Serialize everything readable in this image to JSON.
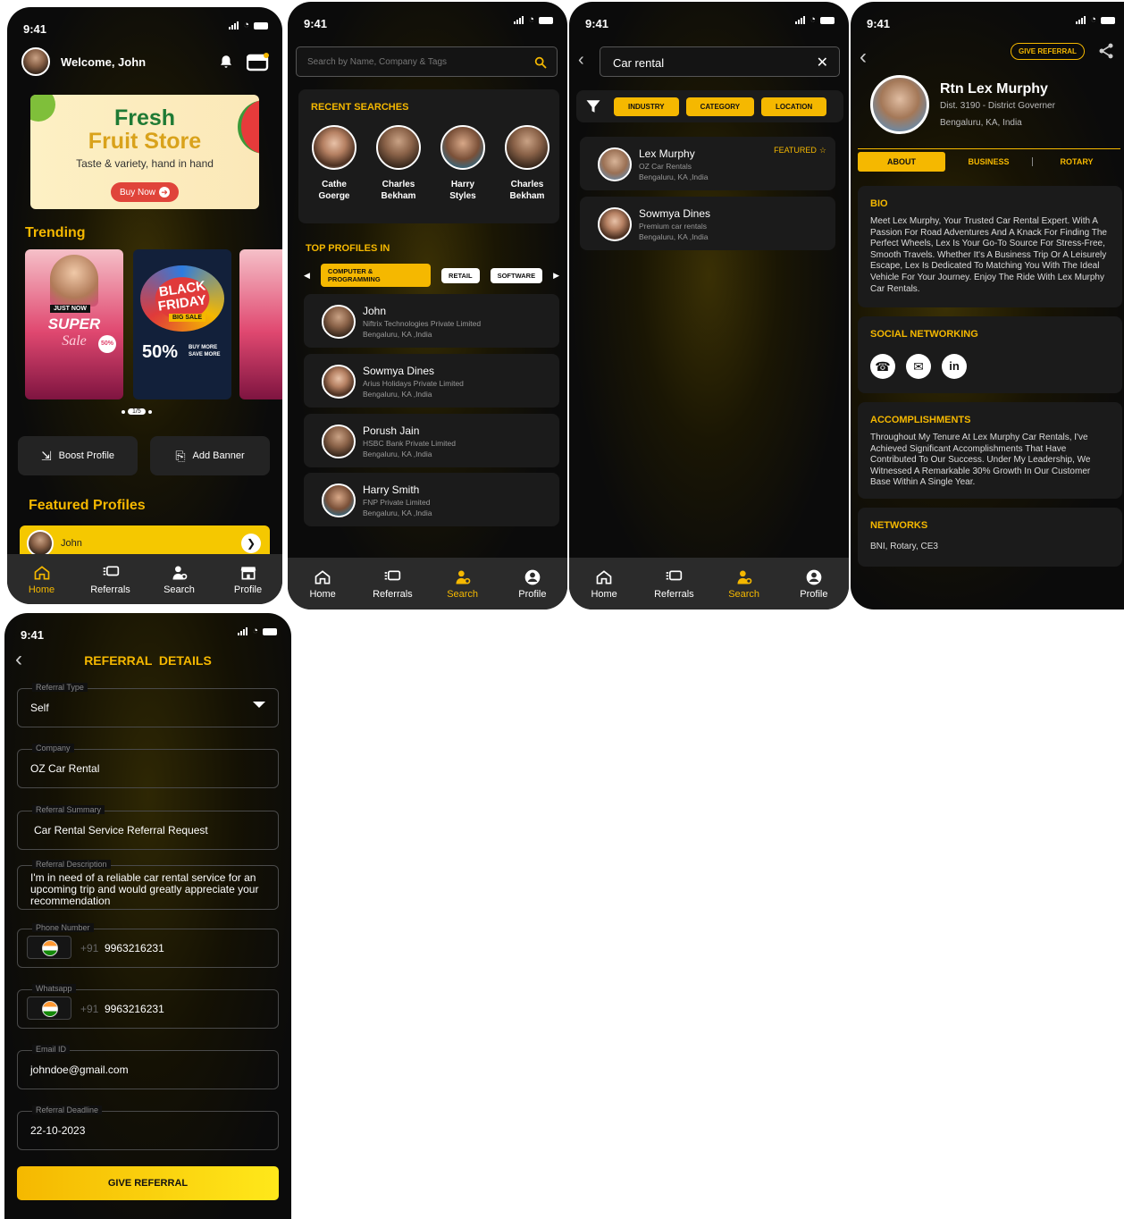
{
  "status_time": "9:41",
  "nav": {
    "home": "Home",
    "referrals": "Referrals",
    "search": "Search",
    "profile": "Profile"
  },
  "home": {
    "welcome": "Welcome, John",
    "banner": {
      "title1": "Fresh",
      "title2": "Fruit Store",
      "tagline": "Taste & variety, hand in hand",
      "cta": "Buy Now"
    },
    "trending_title": "Trending",
    "promo1": {
      "tag": "JUST NOW",
      "title": "SUPER",
      "sub": "Sale",
      "pct": "50%"
    },
    "promo2": {
      "title1": "BLACK",
      "title2": "FRIDAY",
      "tag": "BIG SALE",
      "pct": "50%",
      "more": "BUY MORE SAVE MORE"
    },
    "pager": "1/5",
    "boost": "Boost Profile",
    "add_banner": "Add Banner",
    "featured_title": "Featured Profiles",
    "featured_name": "John"
  },
  "search": {
    "placeholder": "Search by Name, Company & Tags",
    "recent_title": "RECENT SEARCHES",
    "recent": [
      {
        "first": "Cathe",
        "last": "Goerge"
      },
      {
        "first": "Charles",
        "last": "Bekham"
      },
      {
        "first": "Harry",
        "last": "Styles"
      },
      {
        "first": "Charles",
        "last": "Bekham"
      }
    ],
    "top_title": "TOP PROFILES IN",
    "chips": [
      "COMPUTER & PROGRAMMING",
      "RETAIL",
      "SOFTWARE"
    ],
    "profiles": [
      {
        "name": "John",
        "company": "Niftrix Technologies Private Limited",
        "loc": "Bengaluru, KA ,India"
      },
      {
        "name": "Sowmya Dines",
        "company": "Arius Holidays Private Limited",
        "loc": "Bengaluru, KA ,India"
      },
      {
        "name": "Porush Jain",
        "company": "HSBC Bank Private Limited",
        "loc": "Bengaluru, KA ,India"
      },
      {
        "name": "Harry Smith",
        "company": "FNP Private Limited",
        "loc": "Bengaluru, KA ,India"
      }
    ]
  },
  "results": {
    "query": "Car rental",
    "filters": [
      "INDUSTRY",
      "CATEGORY",
      "LOCATION"
    ],
    "featured_label": "FEATURED",
    "items": [
      {
        "name": "Lex Murphy",
        "company": "OZ Car Rentals",
        "loc": "Bengaluru, KA ,India"
      },
      {
        "name": "Sowmya Dines",
        "company": "Premium car rentals",
        "loc": "Bengaluru, KA ,India"
      }
    ]
  },
  "profile": {
    "give_referral": "GIVE REFERRAL",
    "name": "Rtn Lex Murphy",
    "district": "Dist. 3190 - District Governer",
    "location": "Bengaluru, KA, India",
    "tabs": [
      "ABOUT",
      "BUSINESS",
      "ROTARY"
    ],
    "bio_title": "BIO",
    "bio": "Meet Lex Murphy, Your Trusted Car Rental Expert. With A Passion For Road Adventures And A Knack For Finding The Perfect Wheels, Lex Is Your Go-To Source For Stress-Free, Smooth Travels. Whether It's A Business Trip Or A Leisurely Escape, Lex Is Dedicated To Matching You With The Ideal Vehicle For Your Journey. Enjoy The Ride With Lex Murphy Car Rentals.",
    "social_title": "SOCIAL NETWORKING",
    "acc_title": "ACCOMPLISHMENTS",
    "acc": "Throughout My Tenure At Lex Murphy Car Rentals, I've Achieved Significant Accomplishments That Have Contributed To Our Success. Under My Leadership, We Witnessed A Remarkable 30% Growth In Our Customer Base Within A Single Year.",
    "net_title": "NETWORKS",
    "networks": "BNI, Rotary, CE3"
  },
  "referral": {
    "title": "REFERRAL  DETAILS",
    "type_label": "Referral Type",
    "type_val": "Self",
    "company_label": "Company",
    "company_val": "OZ Car Rental",
    "summary_label": "Referral Summary",
    "summary_val": "Car Rental Service Referral Request",
    "desc_label": "Referral Description",
    "desc_val": "I'm in need of a reliable car rental service for an upcoming trip and would greatly appreciate your recommendation",
    "phone_label": "Phone Number",
    "phone_code": "+91",
    "phone_val": "9963216231",
    "wa_label": "Whatsapp",
    "wa_code": "+91",
    "wa_val": "9963216231",
    "email_label": "Email ID",
    "email_val": "johndoe@gmail.com",
    "deadline_label": "Referral Deadline",
    "deadline_val": "22-10-2023",
    "submit": "GIVE REFERRAL"
  }
}
